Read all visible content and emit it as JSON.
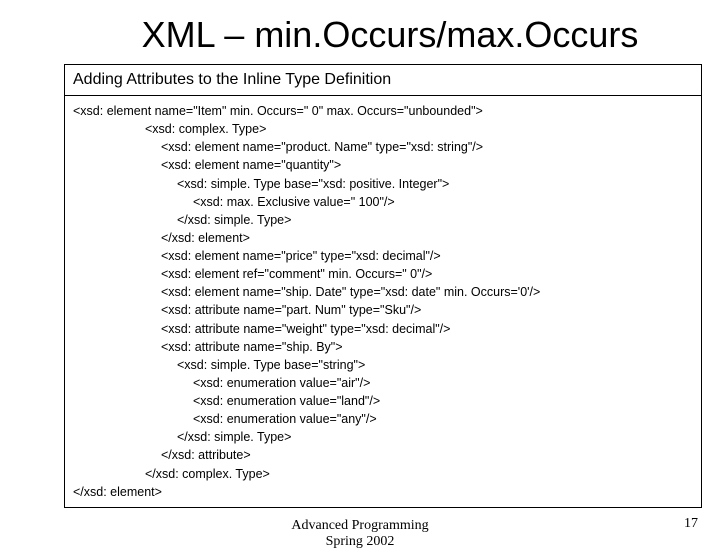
{
  "title": "XML – min.Occurs/max.Occurs",
  "box_header": "Adding Attributes to the Inline Type Definition",
  "lines": {
    "l0": "<xsd: element name=\"Item\" min. Occurs=\" 0\" max. Occurs=\"unbounded\">",
    "l1": "<xsd: complex. Type>",
    "l2": "<xsd: element name=\"product. Name\" type=\"xsd: string\"/>",
    "l3": "<xsd: element name=\"quantity\">",
    "l4": "<xsd: simple. Type base=\"xsd: positive. Integer\">",
    "l5": "<xsd: max. Exclusive value=\" 100\"/>",
    "l6": "</xsd: simple. Type>",
    "l7": "</xsd: element>",
    "l8": "<xsd: element name=\"price\" type=\"xsd: decimal\"/>",
    "l9": "<xsd: element ref=\"comment\" min. Occurs=\" 0\"/>",
    "l10": "<xsd: element name=\"ship. Date\" type=\"xsd: date\" min. Occurs='0'/>",
    "l11": "<xsd: attribute name=\"part. Num\" type=\"Sku\"/>",
    "l12": "<xsd: attribute name=\"weight\" type=\"xsd: decimal\"/>",
    "l13": "<xsd: attribute name=\"ship. By\">",
    "l14": "<xsd: simple. Type base=\"string\">",
    "l15": "<xsd: enumeration value=\"air\"/>",
    "l16": "<xsd: enumeration value=\"land\"/>",
    "l17": "<xsd: enumeration value=\"any\"/>",
    "l18": "</xsd: simple. Type>",
    "l19": "</xsd: attribute>",
    "l20": "</xsd: complex. Type>",
    "l21": "</xsd: element>"
  },
  "footer": {
    "line1": "Advanced Programming",
    "line2": "Spring 2002"
  },
  "page_number": "17"
}
